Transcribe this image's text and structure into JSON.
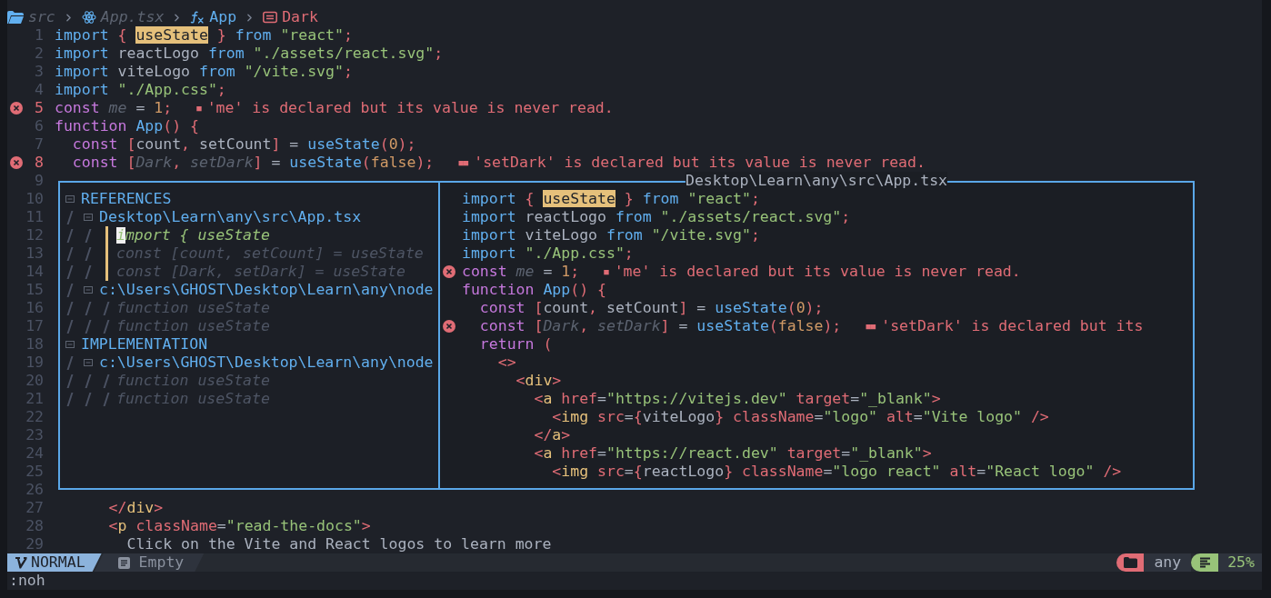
{
  "breadcrumb": [
    {
      "label": "src",
      "kind": "folder"
    },
    {
      "label": "App.tsx",
      "kind": "file"
    },
    {
      "label": "App",
      "kind": "function"
    },
    {
      "label": "Dark",
      "kind": "variable"
    }
  ],
  "lines": [
    {
      "number": "1",
      "error": false,
      "tokens": [
        {
          "text": "import ",
          "kind": "keyword"
        },
        {
          "text": "{ ",
          "kind": "punct"
        },
        {
          "text": "useState",
          "kind": "match"
        },
        {
          "text": " } ",
          "kind": "punct"
        },
        {
          "text": "from ",
          "kind": "keyword"
        },
        {
          "text": "\"react\"",
          "kind": "string"
        },
        {
          "text": ";",
          "kind": "punct"
        }
      ]
    },
    {
      "number": "2",
      "error": false,
      "tokens": [
        {
          "text": "import ",
          "kind": "keyword"
        },
        {
          "text": "reactLogo ",
          "kind": "plain"
        },
        {
          "text": "from ",
          "kind": "keyword"
        },
        {
          "text": "\"./assets/react.svg\"",
          "kind": "string"
        },
        {
          "text": ";",
          "kind": "punct"
        }
      ]
    },
    {
      "number": "3",
      "error": false,
      "tokens": [
        {
          "text": "import ",
          "kind": "keyword"
        },
        {
          "text": "viteLogo ",
          "kind": "plain"
        },
        {
          "text": "from ",
          "kind": "keyword"
        },
        {
          "text": "\"/vite.svg\"",
          "kind": "string"
        },
        {
          "text": ";",
          "kind": "punct"
        }
      ]
    },
    {
      "number": "4",
      "error": false,
      "tokens": [
        {
          "text": "import ",
          "kind": "keyword"
        },
        {
          "text": "\"./App.css\"",
          "kind": "string"
        },
        {
          "text": ";",
          "kind": "punct"
        }
      ]
    },
    {
      "number": "5",
      "error": true,
      "tokens": [
        {
          "text": "const ",
          "kind": "declare"
        },
        {
          "text": "me",
          "kind": "unused"
        },
        {
          "text": " = ",
          "kind": "plain"
        },
        {
          "text": "1",
          "kind": "number"
        },
        {
          "text": ";",
          "kind": "punct"
        }
      ],
      "diagnostic": {
        "marker": "■",
        "message": "'me' is declared but its value is never read."
      }
    },
    {
      "number": "6",
      "error": false,
      "tokens": [
        {
          "text": "function ",
          "kind": "declare"
        },
        {
          "text": "App",
          "kind": "function"
        },
        {
          "text": "() {",
          "kind": "punct"
        }
      ]
    },
    {
      "number": "7",
      "error": false,
      "tokens": [
        {
          "text": "  const ",
          "kind": "declare"
        },
        {
          "text": "[",
          "kind": "punct"
        },
        {
          "text": "count",
          "kind": "plain"
        },
        {
          "text": ", ",
          "kind": "punct"
        },
        {
          "text": "setCount",
          "kind": "plain"
        },
        {
          "text": "]",
          "kind": "punct"
        },
        {
          "text": " = ",
          "kind": "plain"
        },
        {
          "text": "useState",
          "kind": "function"
        },
        {
          "text": "(",
          "kind": "punct"
        },
        {
          "text": "0",
          "kind": "number"
        },
        {
          "text": ");",
          "kind": "punct"
        }
      ]
    },
    {
      "number": "8",
      "error": true,
      "tokens": [
        {
          "text": "  const ",
          "kind": "declare"
        },
        {
          "text": "[",
          "kind": "punct"
        },
        {
          "text": "Dark",
          "kind": "unused"
        },
        {
          "text": ", ",
          "kind": "punct"
        },
        {
          "text": "setDark",
          "kind": "unused"
        },
        {
          "text": "]",
          "kind": "punct"
        },
        {
          "text": " = ",
          "kind": "plain"
        },
        {
          "text": "useState",
          "kind": "function"
        },
        {
          "text": "(",
          "kind": "punct"
        },
        {
          "text": "false",
          "kind": "number"
        },
        {
          "text": ");",
          "kind": "punct"
        }
      ],
      "diagnostic": {
        "marker": "■■",
        "message": "'setDark' is declared but its value is never read."
      }
    },
    {
      "number": "9",
      "error": false
    },
    {
      "number": "10",
      "error": false
    },
    {
      "number": "11",
      "error": false
    },
    {
      "number": "12",
      "error": false
    },
    {
      "number": "13",
      "error": false
    },
    {
      "number": "14",
      "error": false
    },
    {
      "number": "15",
      "error": false
    },
    {
      "number": "16",
      "error": false
    },
    {
      "number": "17",
      "error": false
    },
    {
      "number": "18",
      "error": false
    },
    {
      "number": "19",
      "error": false
    },
    {
      "number": "20",
      "error": false
    },
    {
      "number": "21",
      "error": false
    },
    {
      "number": "22",
      "error": false
    },
    {
      "number": "23",
      "error": false
    },
    {
      "number": "24",
      "error": false
    },
    {
      "number": "25",
      "error": false
    },
    {
      "number": "26",
      "error": false
    },
    {
      "number": "27",
      "error": false,
      "tokens": [
        {
          "text": "      </",
          "kind": "punct"
        },
        {
          "text": "div",
          "kind": "tag"
        },
        {
          "text": ">",
          "kind": "punct"
        }
      ]
    },
    {
      "number": "28",
      "error": false,
      "tokens": [
        {
          "text": "      <",
          "kind": "punct"
        },
        {
          "text": "p ",
          "kind": "tag"
        },
        {
          "text": "className",
          "kind": "attr"
        },
        {
          "text": "=",
          "kind": "plain"
        },
        {
          "text": "\"read-the-docs\"",
          "kind": "string"
        },
        {
          "text": ">",
          "kind": "punct"
        }
      ]
    },
    {
      "number": "29",
      "error": false,
      "tokens": [
        {
          "text": "        Click on the Vite and React logos to learn more",
          "kind": "plain"
        }
      ]
    }
  ],
  "peek": {
    "tree": [
      {
        "label": "REFERENCES",
        "expanded": true,
        "children": [
          {
            "label": "Desktop\\Learn\\any\\src\\App.tsx",
            "expanded": true,
            "current": true,
            "children": [
              {
                "label": "import { useState",
                "selected": true
              },
              {
                "label": "const [count, setCount] = useState",
                "selected": false
              },
              {
                "label": "const [Dark, setDark] = useState",
                "selected": false
              }
            ]
          },
          {
            "label": "c:\\Users\\GHOST\\Desktop\\Learn\\any\\node",
            "expanded": true,
            "current": false,
            "children": [
              {
                "label": "function useState",
                "selected": false
              },
              {
                "label": "function useState",
                "selected": false
              }
            ]
          }
        ]
      },
      {
        "label": "IMPLEMENTATION",
        "expanded": true,
        "children": [
          {
            "label": "c:\\Users\\GHOST\\Desktop\\Learn\\any\\node",
            "expanded": true,
            "current": false,
            "children": [
              {
                "label": "function useState",
                "selected": false
              },
              {
                "label": "function useState",
                "selected": false
              }
            ]
          }
        ]
      }
    ],
    "preview": {
      "title": "Desktop\\Learn\\any\\src\\App.tsx",
      "lines": [
        {
          "error": false,
          "tokens": [
            {
              "text": "import ",
              "kind": "keyword"
            },
            {
              "text": "{ ",
              "kind": "punct"
            },
            {
              "text": "useState",
              "kind": "match"
            },
            {
              "text": " } ",
              "kind": "punct"
            },
            {
              "text": "from ",
              "kind": "keyword"
            },
            {
              "text": "\"react\"",
              "kind": "string"
            },
            {
              "text": ";",
              "kind": "punct"
            }
          ]
        },
        {
          "error": false,
          "tokens": [
            {
              "text": "import ",
              "kind": "keyword"
            },
            {
              "text": "reactLogo ",
              "kind": "plain"
            },
            {
              "text": "from ",
              "kind": "keyword"
            },
            {
              "text": "\"./assets/react.svg\"",
              "kind": "string"
            },
            {
              "text": ";",
              "kind": "punct"
            }
          ]
        },
        {
          "error": false,
          "tokens": [
            {
              "text": "import ",
              "kind": "keyword"
            },
            {
              "text": "viteLogo ",
              "kind": "plain"
            },
            {
              "text": "from ",
              "kind": "keyword"
            },
            {
              "text": "\"/vite.svg\"",
              "kind": "string"
            },
            {
              "text": ";",
              "kind": "punct"
            }
          ]
        },
        {
          "error": false,
          "tokens": [
            {
              "text": "import ",
              "kind": "keyword"
            },
            {
              "text": "\"./App.css\"",
              "kind": "string"
            },
            {
              "text": ";",
              "kind": "punct"
            }
          ]
        },
        {
          "error": true,
          "tokens": [
            {
              "text": "const ",
              "kind": "declare"
            },
            {
              "text": "me",
              "kind": "unused"
            },
            {
              "text": " = ",
              "kind": "plain"
            },
            {
              "text": "1",
              "kind": "number"
            },
            {
              "text": ";",
              "kind": "punct"
            }
          ],
          "diagnostic": {
            "marker": "■",
            "message": "'me' is declared but its value is never read."
          }
        },
        {
          "error": false,
          "tokens": [
            {
              "text": "function ",
              "kind": "declare"
            },
            {
              "text": "App",
              "kind": "function"
            },
            {
              "text": "() {",
              "kind": "punct"
            }
          ]
        },
        {
          "error": false,
          "tokens": [
            {
              "text": "  const ",
              "kind": "declare"
            },
            {
              "text": "[",
              "kind": "punct"
            },
            {
              "text": "count",
              "kind": "plain"
            },
            {
              "text": ", ",
              "kind": "punct"
            },
            {
              "text": "setCount",
              "kind": "plain"
            },
            {
              "text": "]",
              "kind": "punct"
            },
            {
              "text": " = ",
              "kind": "plain"
            },
            {
              "text": "useState",
              "kind": "function"
            },
            {
              "text": "(",
              "kind": "punct"
            },
            {
              "text": "0",
              "kind": "number"
            },
            {
              "text": ");",
              "kind": "punct"
            }
          ]
        },
        {
          "error": true,
          "tokens": [
            {
              "text": "  const ",
              "kind": "declare"
            },
            {
              "text": "[",
              "kind": "punct"
            },
            {
              "text": "Dark",
              "kind": "unused"
            },
            {
              "text": ", ",
              "kind": "punct"
            },
            {
              "text": "setDark",
              "kind": "unused"
            },
            {
              "text": "]",
              "kind": "punct"
            },
            {
              "text": " = ",
              "kind": "plain"
            },
            {
              "text": "useState",
              "kind": "function"
            },
            {
              "text": "(",
              "kind": "punct"
            },
            {
              "text": "false",
              "kind": "number"
            },
            {
              "text": ");",
              "kind": "punct"
            }
          ],
          "diagnostic": {
            "marker": "■■",
            "message": "'setDark' is declared but its"
          }
        },
        {
          "error": false,
          "tokens": [
            {
              "text": "  return ",
              "kind": "declare"
            },
            {
              "text": "(",
              "kind": "punct"
            }
          ]
        },
        {
          "error": false,
          "tokens": [
            {
              "text": "    <>",
              "kind": "punct"
            }
          ]
        },
        {
          "error": false,
          "tokens": [
            {
              "text": "      <",
              "kind": "punct"
            },
            {
              "text": "div",
              "kind": "tag"
            },
            {
              "text": ">",
              "kind": "punct"
            }
          ]
        },
        {
          "error": false,
          "tokens": [
            {
              "text": "        <",
              "kind": "punct"
            },
            {
              "text": "a ",
              "kind": "tag"
            },
            {
              "text": "href",
              "kind": "attr"
            },
            {
              "text": "=",
              "kind": "plain"
            },
            {
              "text": "\"https://vitejs.dev\" ",
              "kind": "string"
            },
            {
              "text": "target",
              "kind": "attr"
            },
            {
              "text": "=",
              "kind": "plain"
            },
            {
              "text": "\"_blank\"",
              "kind": "string"
            },
            {
              "text": ">",
              "kind": "punct"
            }
          ]
        },
        {
          "error": false,
          "tokens": [
            {
              "text": "          <",
              "kind": "punct"
            },
            {
              "text": "img ",
              "kind": "tag"
            },
            {
              "text": "src",
              "kind": "attr"
            },
            {
              "text": "=",
              "kind": "plain"
            },
            {
              "text": "{",
              "kind": "punct"
            },
            {
              "text": "viteLogo",
              "kind": "plain"
            },
            {
              "text": "} ",
              "kind": "punct"
            },
            {
              "text": "className",
              "kind": "attr"
            },
            {
              "text": "=",
              "kind": "plain"
            },
            {
              "text": "\"logo\" ",
              "kind": "string"
            },
            {
              "text": "alt",
              "kind": "attr"
            },
            {
              "text": "=",
              "kind": "plain"
            },
            {
              "text": "\"Vite logo\"",
              "kind": "string"
            },
            {
              "text": " />",
              "kind": "punct"
            }
          ]
        },
        {
          "error": false,
          "tokens": [
            {
              "text": "        </",
              "kind": "punct"
            },
            {
              "text": "a",
              "kind": "tag"
            },
            {
              "text": ">",
              "kind": "punct"
            }
          ]
        },
        {
          "error": false,
          "tokens": [
            {
              "text": "        <",
              "kind": "punct"
            },
            {
              "text": "a ",
              "kind": "tag"
            },
            {
              "text": "href",
              "kind": "attr"
            },
            {
              "text": "=",
              "kind": "plain"
            },
            {
              "text": "\"https://react.dev\" ",
              "kind": "string"
            },
            {
              "text": "target",
              "kind": "attr"
            },
            {
              "text": "=",
              "kind": "plain"
            },
            {
              "text": "\"_blank\"",
              "kind": "string"
            },
            {
              "text": ">",
              "kind": "punct"
            }
          ]
        },
        {
          "error": false,
          "tokens": [
            {
              "text": "          <",
              "kind": "punct"
            },
            {
              "text": "img ",
              "kind": "tag"
            },
            {
              "text": "src",
              "kind": "attr"
            },
            {
              "text": "=",
              "kind": "plain"
            },
            {
              "text": "{",
              "kind": "punct"
            },
            {
              "text": "reactLogo",
              "kind": "plain"
            },
            {
              "text": "} ",
              "kind": "punct"
            },
            {
              "text": "className",
              "kind": "attr"
            },
            {
              "text": "=",
              "kind": "plain"
            },
            {
              "text": "\"logo react\" ",
              "kind": "string"
            },
            {
              "text": "alt",
              "kind": "attr"
            },
            {
              "text": "=",
              "kind": "plain"
            },
            {
              "text": "\"React logo\"",
              "kind": "string"
            },
            {
              "text": " />",
              "kind": "punct"
            }
          ]
        }
      ]
    }
  },
  "statusline": {
    "mode": "NORMAL",
    "buffer": "Empty",
    "directory": "any",
    "progress": "25%"
  },
  "command_line": ":noh"
}
